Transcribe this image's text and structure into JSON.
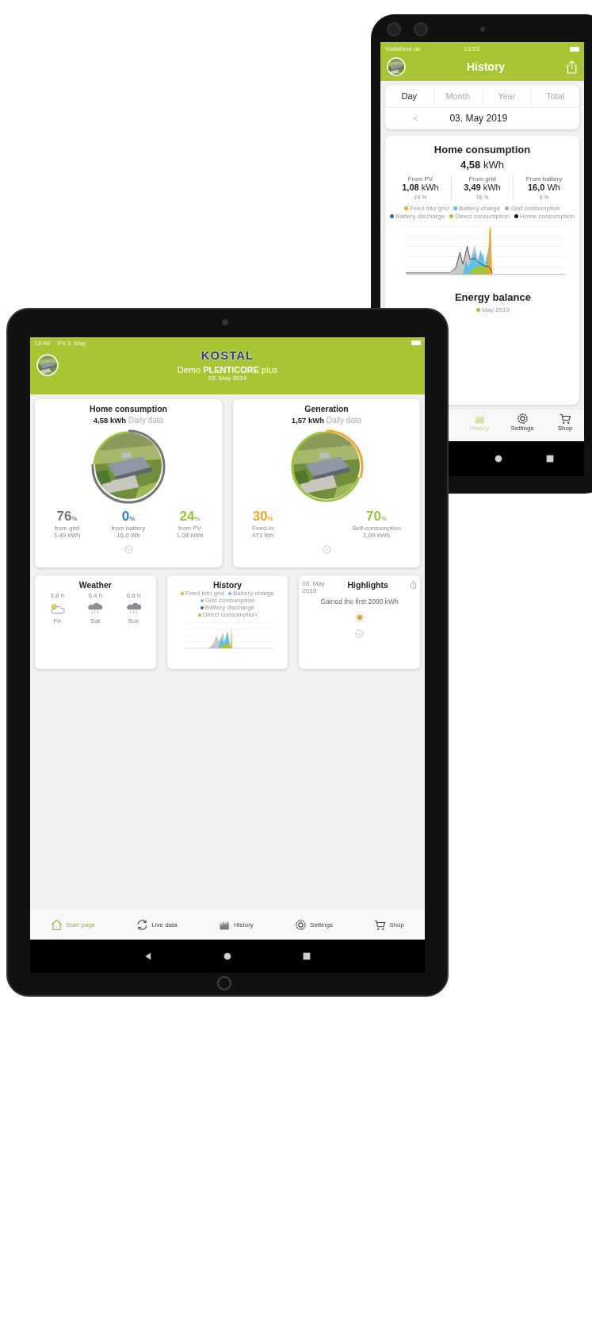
{
  "phone": {
    "status": {
      "carrier": "Vodafone.de",
      "time": "13:53"
    },
    "title": "History",
    "tabs": [
      {
        "label": "Day",
        "selected": true
      },
      {
        "label": "Month",
        "selected": false
      },
      {
        "label": "Year",
        "selected": false
      },
      {
        "label": "Total",
        "selected": false
      }
    ],
    "prev": "<",
    "date": "03. May 2019",
    "consumption": {
      "title": "Home consumption",
      "total": "4,58",
      "unit": "kWh",
      "sources": [
        {
          "label": "From PV",
          "value": "1,08",
          "unit": "kWh",
          "share": "24 %"
        },
        {
          "label": "From grid",
          "value": "3,49",
          "unit": "kWh",
          "share": "76 %"
        },
        {
          "label": "From battery",
          "value": "16,0",
          "unit": "Wh",
          "share": "0 %"
        }
      ]
    },
    "legend": [
      {
        "label": "Feed into grid",
        "color": "#f5a623"
      },
      {
        "label": "Battery charge",
        "color": "#5bc0eb"
      },
      {
        "label": "Grid consumption",
        "color": "#aaaaaa"
      },
      {
        "label": "Battery discharge",
        "color": "#1f6fb5"
      },
      {
        "label": "Direct consumption",
        "color": "#a8c632"
      },
      {
        "label": "Home consumption",
        "color": "#111111"
      }
    ],
    "balance": {
      "title": "Energy balance",
      "legend": [
        {
          "label": "May 2019",
          "color": "#a8c632"
        }
      ]
    },
    "nav": [
      {
        "label": "History",
        "kind": "history",
        "selected": true
      },
      {
        "label": "Settings",
        "kind": "settings",
        "selected": false
      },
      {
        "label": "Shop",
        "kind": "shop",
        "selected": false
      }
    ]
  },
  "tablet": {
    "status": {
      "time": "13:48",
      "date": "Fri 3. May"
    },
    "logo": "KOSTAL",
    "title": "Demo **PLENTICORE** plus",
    "subtitle": "03. May 2019",
    "cards": [
      {
        "title": "Home consumption",
        "value": "4,58 kWh",
        "note": "Daily data",
        "ring": [
          {
            "level": 0.76,
            "color": "#777777"
          },
          {
            "level": 0.24,
            "color": "#9bc43a"
          }
        ],
        "stats": [
          {
            "value": "76",
            "unit": "%",
            "label": "from grid",
            "sub": "3,49 kWh",
            "color": "#777777"
          },
          {
            "value": "0",
            "unit": "%",
            "label": "from battery",
            "sub": "16,0 Wh",
            "color": "#2a7fc0"
          },
          {
            "value": "24",
            "unit": "%",
            "label": "from PV",
            "sub": "1,08 kWh",
            "color": "#9bc43a"
          }
        ]
      },
      {
        "title": "Generation",
        "value": "1,57 kWh",
        "note": "Daily data",
        "ring": [
          {
            "level": 0.3,
            "color": "#f5a623"
          },
          {
            "level": 0.7,
            "color": "#9bc43a"
          }
        ],
        "stats": [
          {
            "value": "30",
            "unit": "%",
            "label": "Feed-in",
            "sub": "471 Wh",
            "color": "#f5a623"
          },
          {
            "value": "70",
            "unit": "%",
            "label": "Self-consumption",
            "sub": "1,09 kWh",
            "color": "#9bc43a"
          }
        ]
      }
    ],
    "weather": {
      "title": "Weather",
      "days": [
        {
          "hours": "3,8 h",
          "kind": "partly-cloudy",
          "day": "Fri"
        },
        {
          "hours": "6,4 h",
          "kind": "rain",
          "day": "Sat"
        },
        {
          "hours": "6,8 h",
          "kind": "rain",
          "day": "Sun"
        }
      ]
    },
    "history": {
      "title": "History",
      "legend": [
        {
          "label": "Feed into grid",
          "color": "#f5a623"
        },
        {
          "label": "Battery charge",
          "color": "#5bc0eb"
        },
        {
          "label": "Grid consumption",
          "color": "#aaaaaa"
        },
        {
          "label": "Battery discharge",
          "color": "#1f6fb5"
        },
        {
          "label": "Direct consumption",
          "color": "#a8c632"
        }
      ]
    },
    "highlights": {
      "date": "03. May 2019",
      "title": "Highlights",
      "text": "Gained the first 2000 kWh"
    },
    "nav": [
      {
        "label": "Start page",
        "kind": "home",
        "selected": true
      },
      {
        "label": "Live data",
        "kind": "live",
        "selected": false
      },
      {
        "label": "History",
        "kind": "history",
        "selected": false
      },
      {
        "label": "Settings",
        "kind": "settings",
        "selected": false
      },
      {
        "label": "Shop",
        "kind": "shop",
        "selected": false
      }
    ]
  }
}
